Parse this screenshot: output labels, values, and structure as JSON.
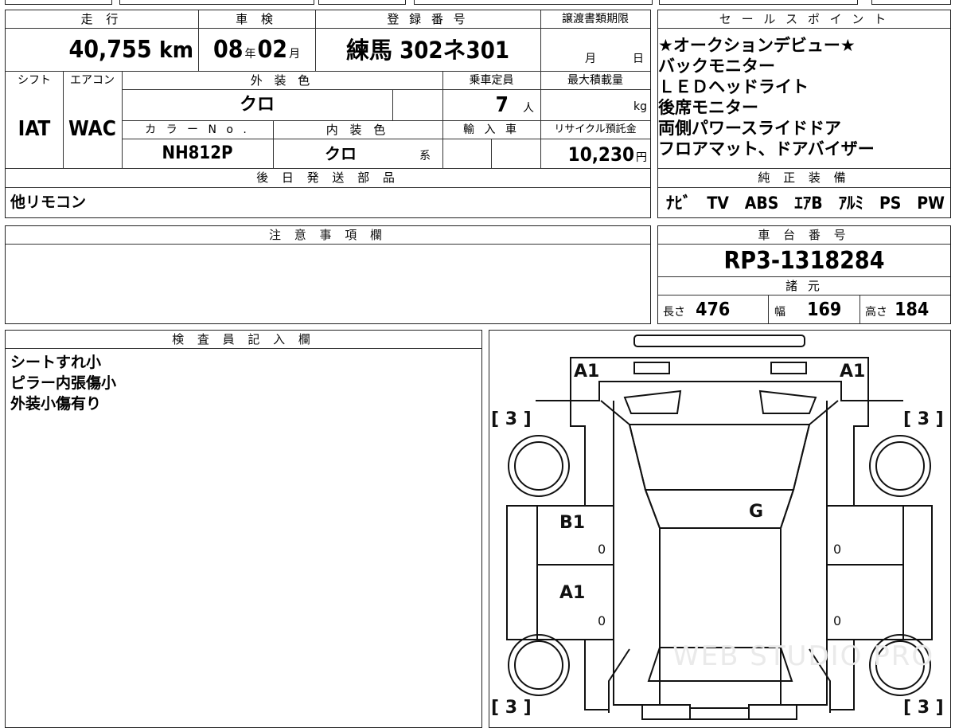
{
  "top_section": {
    "mileage_label": "走 行",
    "mileage_value": "40,755",
    "mileage_unit": "km",
    "inspection_label": "車 検",
    "inspection_year": "08",
    "inspection_year_unit": "年",
    "inspection_month": "02",
    "inspection_month_unit": "月",
    "registration_label": "登 録 番 号",
    "registration_value": "練馬 302ネ301",
    "transfer_label": "譲渡書類期限",
    "transfer_month_unit": "月",
    "transfer_day_unit": "日"
  },
  "spec_row": {
    "shift_label": "シフト",
    "shift_value": "IAT",
    "aircon_label": "エアコン",
    "aircon_value": "WAC",
    "exterior_color_label": "外 装 色",
    "exterior_color_value": "クロ",
    "capacity_label": "乗車定員",
    "capacity_value": "7",
    "capacity_unit": "人",
    "max_load_label": "最大積載量",
    "max_load_unit": "kg",
    "color_no_label": "カ ラ ー N o .",
    "color_no_value": "NH812P",
    "interior_color_label": "内 装 色",
    "interior_color_value": "クロ",
    "interior_color_suffix": "系",
    "import_label": "輸 入 車",
    "recycle_label": "リサイクル預託金",
    "recycle_value": "10,230",
    "recycle_unit": "円"
  },
  "later_parts": {
    "label": "後 日 発 送 部 品",
    "value": "他リモコン"
  },
  "sales_points": {
    "label": "セ ー ル ス ポ イ ン ト",
    "lines": [
      "★オークションデビュー★",
      "バックモニター",
      "ＬＥＤヘッドライト",
      "後席モニター",
      "両側パワースライドドア",
      "フロアマット、ドアバイザー"
    ]
  },
  "genuine_equipment": {
    "label": "純 正 装 備",
    "items": [
      "ﾅﾋﾞ",
      "TV",
      "ABS",
      "ｴｱB",
      "ｱﾙﾐ",
      "PS",
      "PW"
    ]
  },
  "notes": {
    "label": "注 意 事 項 欄"
  },
  "chassis": {
    "label": "車 台 番 号",
    "value": "RP3-1318284"
  },
  "dimensions": {
    "label": "諸 元",
    "length_label": "長さ",
    "length_value": "476",
    "width_label": "幅",
    "width_value": "169",
    "height_label": "高さ",
    "height_value": "184"
  },
  "inspector": {
    "label": "検 査 員 記 入 欄",
    "lines": [
      "シートすれ小",
      "ピラー内張傷小",
      "外装小傷有り"
    ]
  },
  "damage_map": {
    "front_left": "A1",
    "front_right": "A1",
    "tire_fl": "[ 3 ]",
    "tire_fr": "[ 3 ]",
    "tire_rl": "[ 3 ]",
    "tire_rr": "[ 3 ]",
    "left_front_door": "B1",
    "left_rear_door": "A1",
    "roof": "G",
    "zero_1": "0",
    "zero_2": "0",
    "zero_3": "0",
    "zero_4": "0",
    "watermark": "WEB STUDIO PRO"
  }
}
